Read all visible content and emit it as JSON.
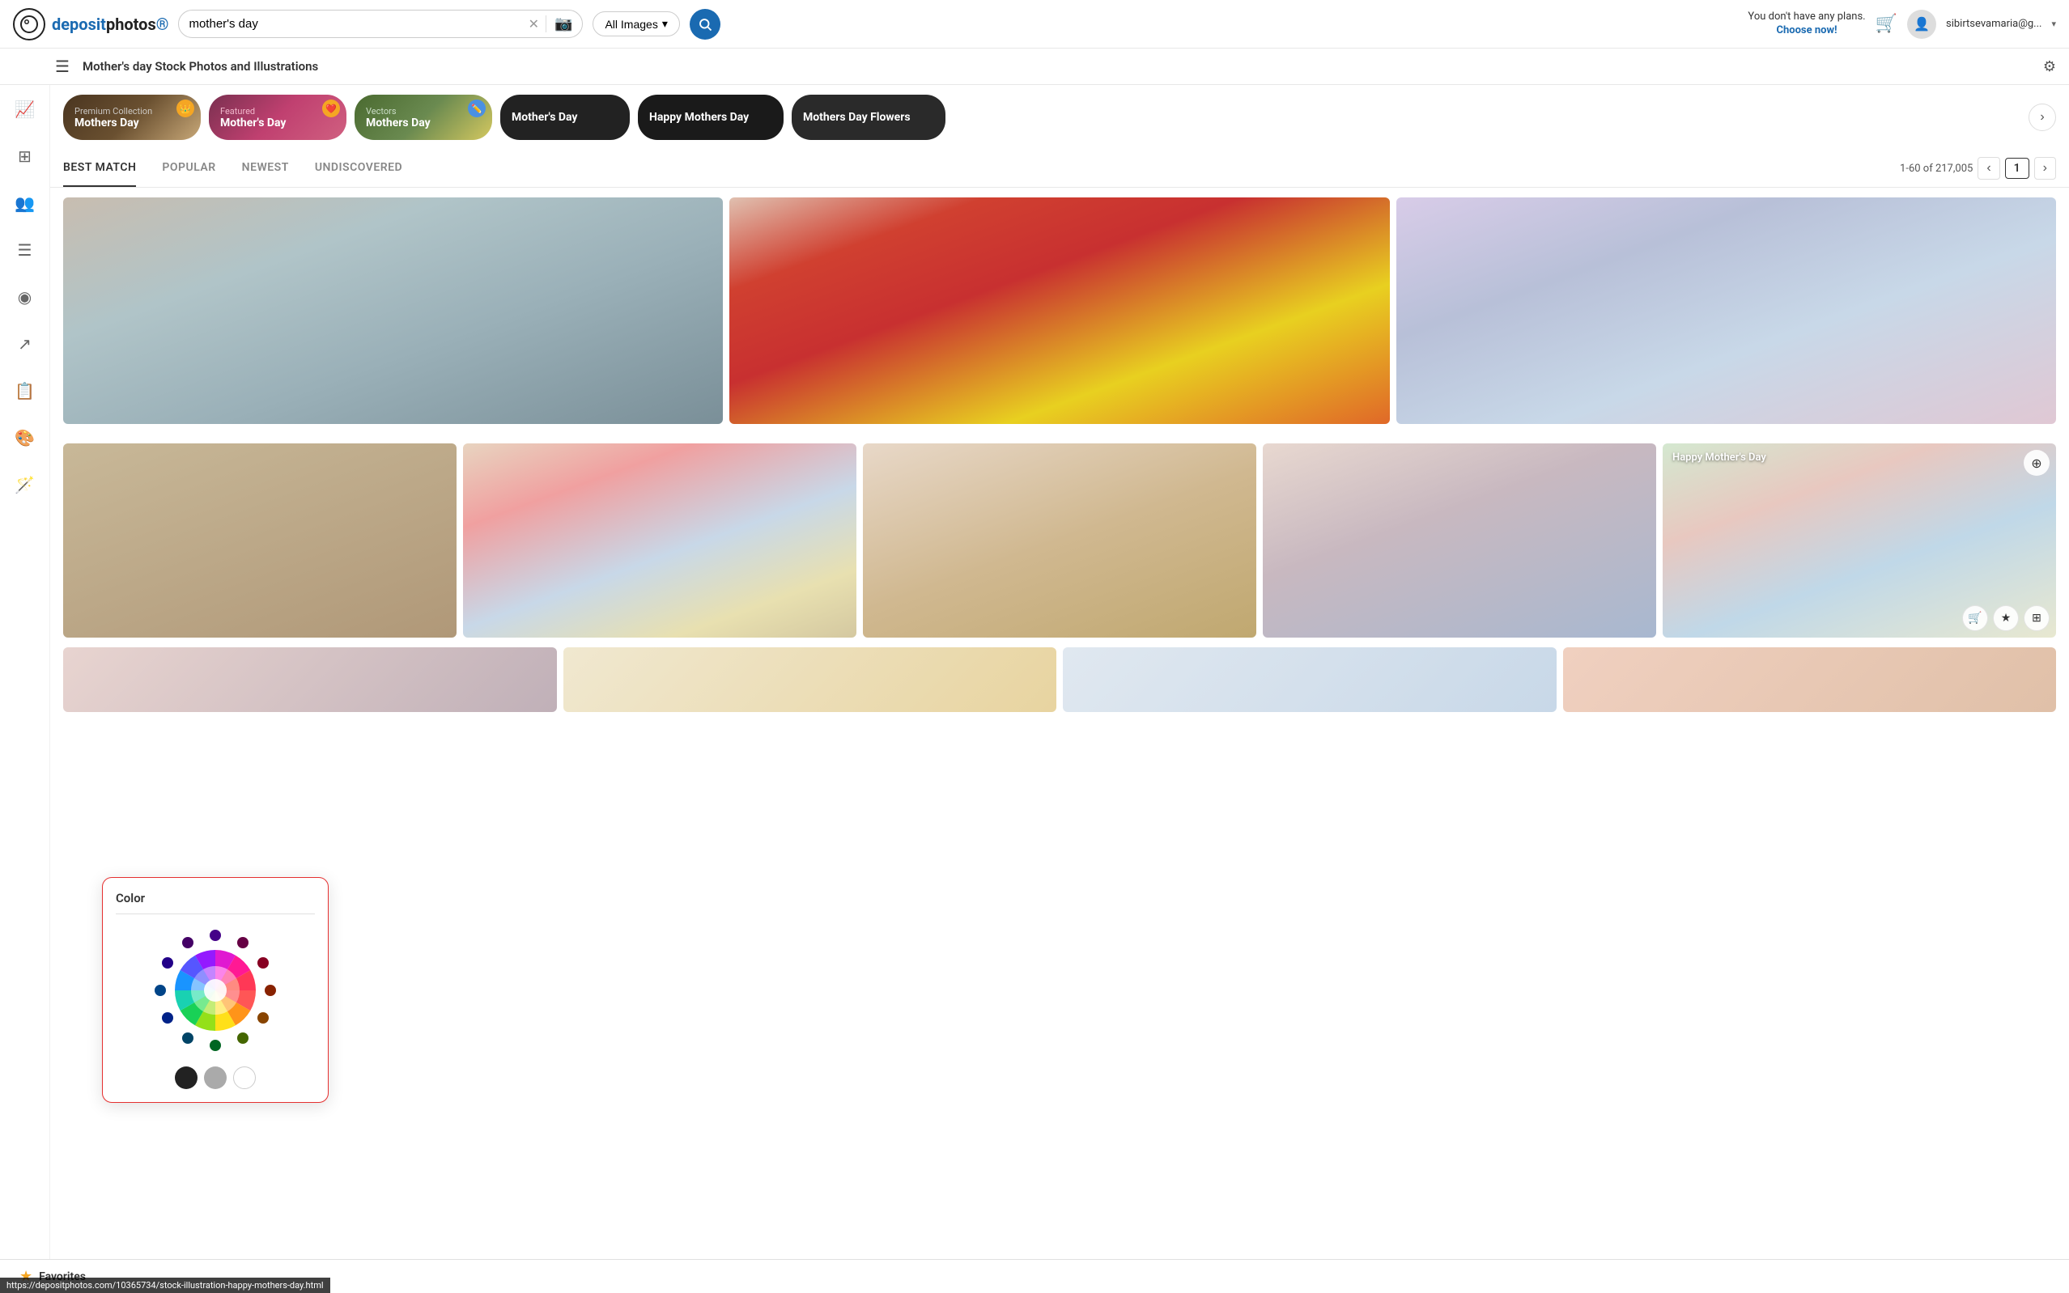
{
  "header": {
    "logo_text": "depositphotos",
    "search_value": "mother's day",
    "search_placeholder": "mother's day",
    "filter_label": "All Images",
    "search_btn_label": "🔍",
    "plans_line1": "You don't have any plans.",
    "plans_line2": "Choose now!",
    "user_email": "sibirtsevamaria@g..."
  },
  "sub_header": {
    "title": "Mother's day Stock Photos and Illustrations"
  },
  "categories": [
    {
      "sub": "Premium Collection",
      "main": "Mothers Day",
      "badge": "👑",
      "badge_color": "orange",
      "bg": "#4a3a2a"
    },
    {
      "sub": "Featured",
      "main": "Mother's Day",
      "badge": "❤️",
      "badge_color": "orange",
      "bg": "#8b4060"
    },
    {
      "sub": "Vectors",
      "main": "Mothers Day",
      "badge": "✏️",
      "badge_color": "blue",
      "bg": "#5a7a4a"
    },
    {
      "sub": "",
      "main": "Mother's Day",
      "badge": "",
      "badge_color": "",
      "bg": "#2a2a2a"
    },
    {
      "sub": "",
      "main": "Happy Mothers Day",
      "badge": "",
      "badge_color": "",
      "bg": "#1a1a1a"
    },
    {
      "sub": "",
      "main": "Mothers Day Flowers",
      "badge": "",
      "badge_color": "",
      "bg": "#222"
    }
  ],
  "tabs": [
    {
      "label": "Best Match",
      "active": true
    },
    {
      "label": "Popular",
      "active": false
    },
    {
      "label": "Newest",
      "active": false
    },
    {
      "label": "Undiscovered",
      "active": false
    }
  ],
  "pagination": {
    "range": "1-60 of 217,005",
    "current_page": "1"
  },
  "color_popup": {
    "title": "Color"
  },
  "image_cards": [
    {
      "id": 1,
      "label": ""
    },
    {
      "id": 2,
      "label": ""
    },
    {
      "id": 3,
      "label": ""
    },
    {
      "id": 4,
      "label": ""
    },
    {
      "id": 5,
      "label": ""
    },
    {
      "id": 6,
      "label": ""
    },
    {
      "id": 7,
      "label": ""
    },
    {
      "id": 8,
      "label": "Happy Mother's Day"
    }
  ],
  "favorites": {
    "label": "Favorites"
  },
  "status_bar": {
    "url": "https://depositphotos.com/10365734/stock-illustration-happy-mothers-day.html"
  },
  "sidebar_icons": [
    {
      "name": "trending-icon",
      "symbol": "📈"
    },
    {
      "name": "layers-icon",
      "symbol": "⊞"
    },
    {
      "name": "people-icon",
      "symbol": "👥"
    },
    {
      "name": "list-icon",
      "symbol": "☰"
    },
    {
      "name": "circle-user-icon",
      "symbol": "◉"
    },
    {
      "name": "chart-icon",
      "symbol": "↗"
    },
    {
      "name": "doc-icon",
      "symbol": "📋"
    },
    {
      "name": "palette-icon",
      "symbol": "🎨"
    },
    {
      "name": "wand-icon",
      "symbol": "🪄"
    }
  ]
}
